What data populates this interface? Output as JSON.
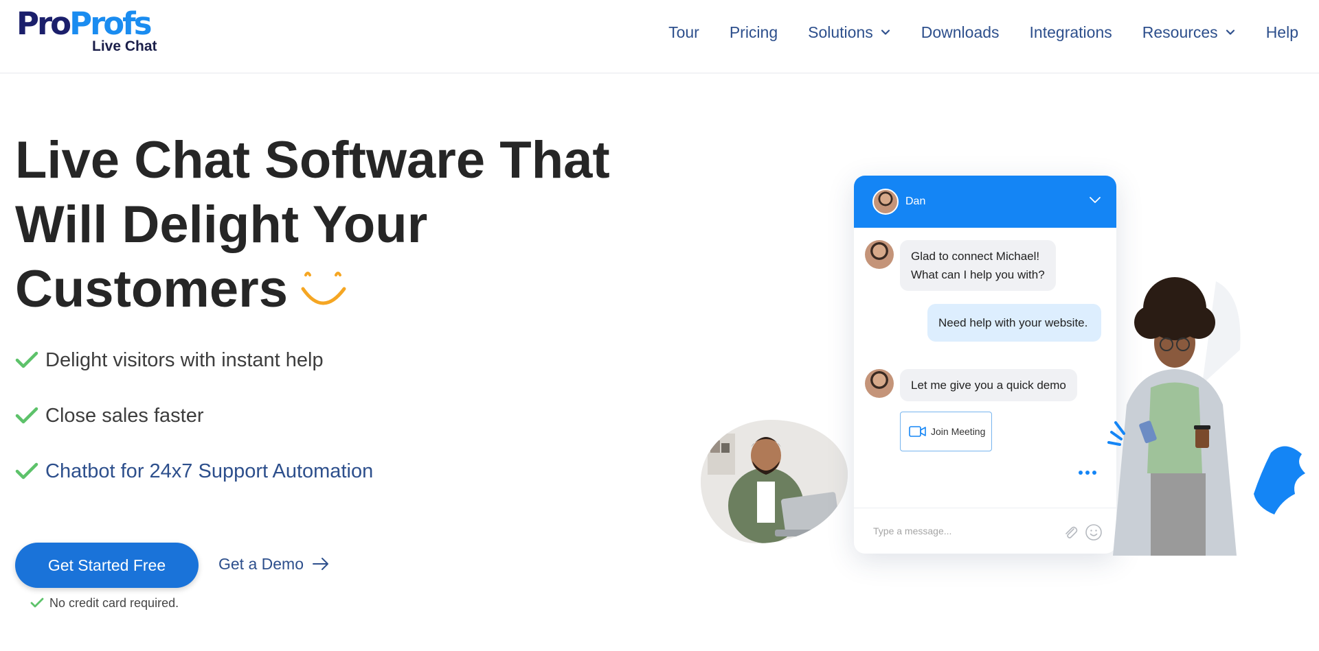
{
  "brand": {
    "logo_part1": "Pro",
    "logo_part2": "Profs",
    "logo_sub": "Live Chat",
    "colors": {
      "navy": "#1b1f6b",
      "blue": "#1a8cf0"
    }
  },
  "nav": {
    "items": [
      {
        "label": "Tour",
        "has_dropdown": false
      },
      {
        "label": "Pricing",
        "has_dropdown": false
      },
      {
        "label": "Solutions",
        "has_dropdown": true
      },
      {
        "label": "Downloads",
        "has_dropdown": false
      },
      {
        "label": "Integrations",
        "has_dropdown": false
      },
      {
        "label": "Resources",
        "has_dropdown": true
      },
      {
        "label": "Help",
        "has_dropdown": false
      }
    ],
    "color": "#2d4f8c"
  },
  "hero": {
    "title_lines": [
      "Live Chat Software That",
      "Will Delight Your",
      "Customers"
    ],
    "smile_icon": "smile-icon",
    "smile_color": "#f5a623",
    "features": [
      {
        "text": "Delight visitors with instant help",
        "is_link": false
      },
      {
        "text": "Close sales faster",
        "is_link": false
      },
      {
        "text": "Chatbot for 24x7 Support Automation",
        "is_link": true
      }
    ],
    "check_color": "#5dc26a",
    "cta_label": "Get Started Free",
    "cta_color": "#1a73d9",
    "demo_label": "Get a Demo",
    "no_cc_text": "No credit card required."
  },
  "chat_widget": {
    "agent_name": "Dan",
    "header_color": "#1485f5",
    "messages": [
      {
        "from": "agent",
        "lines": [
          "Glad to connect Michael!",
          "What can I help you with?"
        ]
      },
      {
        "from": "visitor",
        "lines": [
          "Need help with your website."
        ]
      },
      {
        "from": "agent",
        "lines": [
          "Let me give you a quick demo"
        ]
      }
    ],
    "join_meeting_label": "Join Meeting",
    "input_placeholder": "Type a message..."
  }
}
